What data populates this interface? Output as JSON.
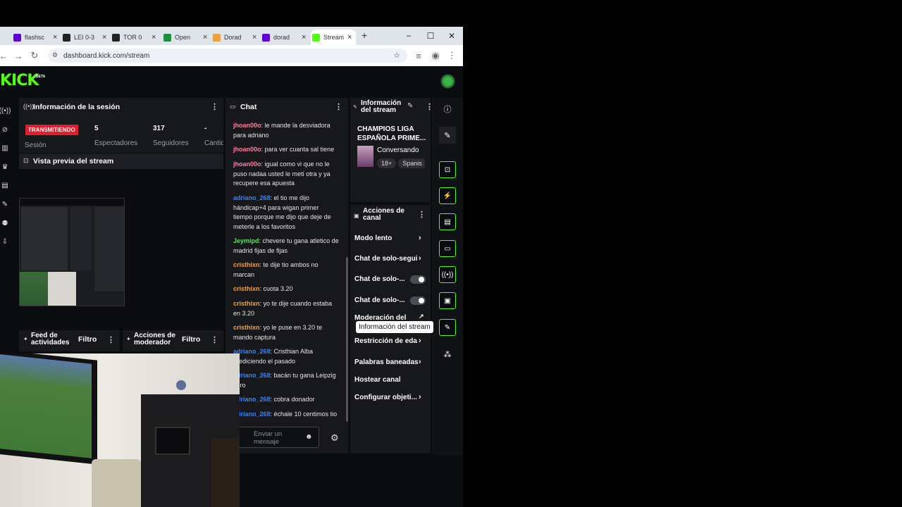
{
  "browser": {
    "tabs": [
      {
        "title": "flashsc",
        "icon": "yahoo-icon",
        "color": "#6001d2"
      },
      {
        "title": "LEI 0-3",
        "icon": "c-icon",
        "color": "#222222"
      },
      {
        "title": "TOR 0",
        "icon": "c-icon",
        "color": "#222222"
      },
      {
        "title": "Open",
        "icon": "sheets-icon",
        "color": "#1e8e3e"
      },
      {
        "title": "Dorad",
        "icon": "y-icon",
        "color": "#e8a33a"
      },
      {
        "title": "dorad",
        "icon": "yahoo-icon",
        "color": "#6001d2"
      },
      {
        "title": "Stream",
        "icon": "kick-icon",
        "color": "#53fc18"
      }
    ],
    "new_tab": "+",
    "minimize": "−",
    "maximize": "☐",
    "close": "✕",
    "url": "dashboard.kick.com/stream"
  },
  "app": {
    "logo": "KICK",
    "beta": "BETA",
    "accent": "#53fc18"
  },
  "session": {
    "title": "Información de la sesión",
    "live_badge": "TRANSMITIENDO",
    "session_label": "Sesión",
    "stats": [
      {
        "value": "5",
        "label": "Espectadores"
      },
      {
        "value": "317",
        "label": "Seguidores"
      },
      {
        "value": "-",
        "label": "Cantid"
      }
    ]
  },
  "preview": {
    "title": "Vista previa del stream"
  },
  "feed": {
    "title_line1": "Feed de",
    "title_line2": "actividades",
    "filter": "Filtro"
  },
  "modactions": {
    "title_line1": "Acciones de",
    "title_line2": "moderador",
    "filter": "Filtro"
  },
  "chat": {
    "title": "Chat",
    "placeholder_line1": "Enviar un",
    "placeholder_line2": "mensaje",
    "messages": [
      {
        "user": "jhoan00o",
        "text": ": le mande la desviadora para adriano",
        "color": "pink"
      },
      {
        "user": "jhoan00o",
        "text": ": para ver cuanta sal tiene",
        "color": "pink"
      },
      {
        "user": "jhoan00o",
        "text": ": igual como vi que no le puso nadaa usted le meti otra y ya recupere esa apuesta",
        "color": "pink"
      },
      {
        "user": "adriano_268",
        "text": ": el tio me dijo hándicap+4 para wigan primer tiempo porque me dijo que deje de meterle a los favoritos",
        "color": "blue"
      },
      {
        "user": "Jeymipd",
        "text": ": chevere tu gana atletico de madrid fijas de fijas",
        "color": "green"
      },
      {
        "user": "cristhixn",
        "text": ": te dije tio ambos no marcan",
        "color": "orange"
      },
      {
        "user": "cristhixn",
        "text": ": cuota 3.20",
        "color": "orange"
      },
      {
        "user": "cristhixn",
        "text": ": yo te dije cuando estaba en 3.20",
        "color": "orange"
      },
      {
        "user": "cristhixn",
        "text": ": yo le puse en 3.20 te mando captura",
        "color": "orange"
      },
      {
        "user": "adriano_268",
        "text": ": Cristhian Alba prediciendo el pasado",
        "color": "blue"
      },
      {
        "user": "adriano_268",
        "text": ": bacán tu gana Leipzig cero",
        "color": "blue"
      },
      {
        "user": "adriano_268",
        "text": ": cobra donador",
        "color": "blue"
      },
      {
        "user": "adriano_268",
        "text": ": échale 10 centimos tio",
        "color": "blue"
      }
    ]
  },
  "stream_info": {
    "title_line1": "Información",
    "title_line2": "del stream",
    "stream_title_line1": "CHAMPIOS LIGA",
    "stream_title_line2": "ESPAÑOLA PRIME...",
    "category": "Conversando",
    "tags": [
      "18+",
      "Spanis"
    ]
  },
  "channel_actions": {
    "title_line1": "Acciones de",
    "title_line2": "canal",
    "items": [
      {
        "label": "Modo lento",
        "control": "chevron"
      },
      {
        "label": "Chat de solo-segui",
        "control": "chevron"
      },
      {
        "label": "Chat de solo-...",
        "control": "toggle",
        "state": "off"
      },
      {
        "label": "Chat de solo-...",
        "control": "toggle",
        "state": "off"
      },
      {
        "label": "Moderación del",
        "control": "link"
      },
      {
        "label": "Restricción de eda",
        "control": "chevron"
      },
      {
        "label": "Palabras baneadas",
        "control": "chevron"
      },
      {
        "label": "Hostear canal",
        "control": "none"
      },
      {
        "label": "Configurar objeti...",
        "control": "chevron"
      }
    ]
  },
  "tooltip": "Información del stream"
}
